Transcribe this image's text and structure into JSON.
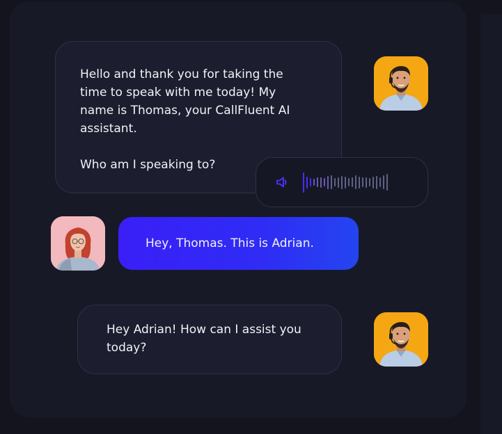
{
  "assistant": {
    "name": "Thomas",
    "avatar_icon": "male-agent-headset-avatar",
    "avatar_bg": "#f4a712"
  },
  "user": {
    "name": "Adrian",
    "avatar_icon": "female-user-avatar",
    "avatar_bg": "#f2b9be"
  },
  "messages": [
    {
      "sender": "assistant",
      "paragraphs": [
        "Hello and thank you for taking the\ntime to speak with me today! My\nname  is Thomas, your CallFluent AI\nassistant.",
        "Who am I speaking to?"
      ]
    },
    {
      "sender": "user",
      "text": "Hey, Thomas. This is Adrian."
    },
    {
      "sender": "assistant",
      "text": "Hey Adrian! How can I assist you\ntoday?"
    }
  ],
  "audio_player": {
    "icon": "speaker-icon",
    "waveform_levels": [
      0.85,
      0.5,
      0.35,
      0.3,
      0.4,
      0.45,
      0.35,
      0.55,
      0.6,
      0.35,
      0.45,
      0.55,
      0.5,
      0.35,
      0.4,
      0.6,
      0.5,
      0.4,
      0.45,
      0.35,
      0.5,
      0.55,
      0.4,
      0.6,
      0.7
    ],
    "waveform_gradient": [
      "#4a2cff",
      "#5a5f88"
    ]
  },
  "colors": {
    "background": "#14141e",
    "card": "#181927",
    "assistant_bubble": "#1c1d2e",
    "user_bubble_start": "#3a1ff7",
    "user_bubble_end": "#2445f0",
    "text": "#f2f2f7",
    "accent": "#3d2cf5"
  }
}
